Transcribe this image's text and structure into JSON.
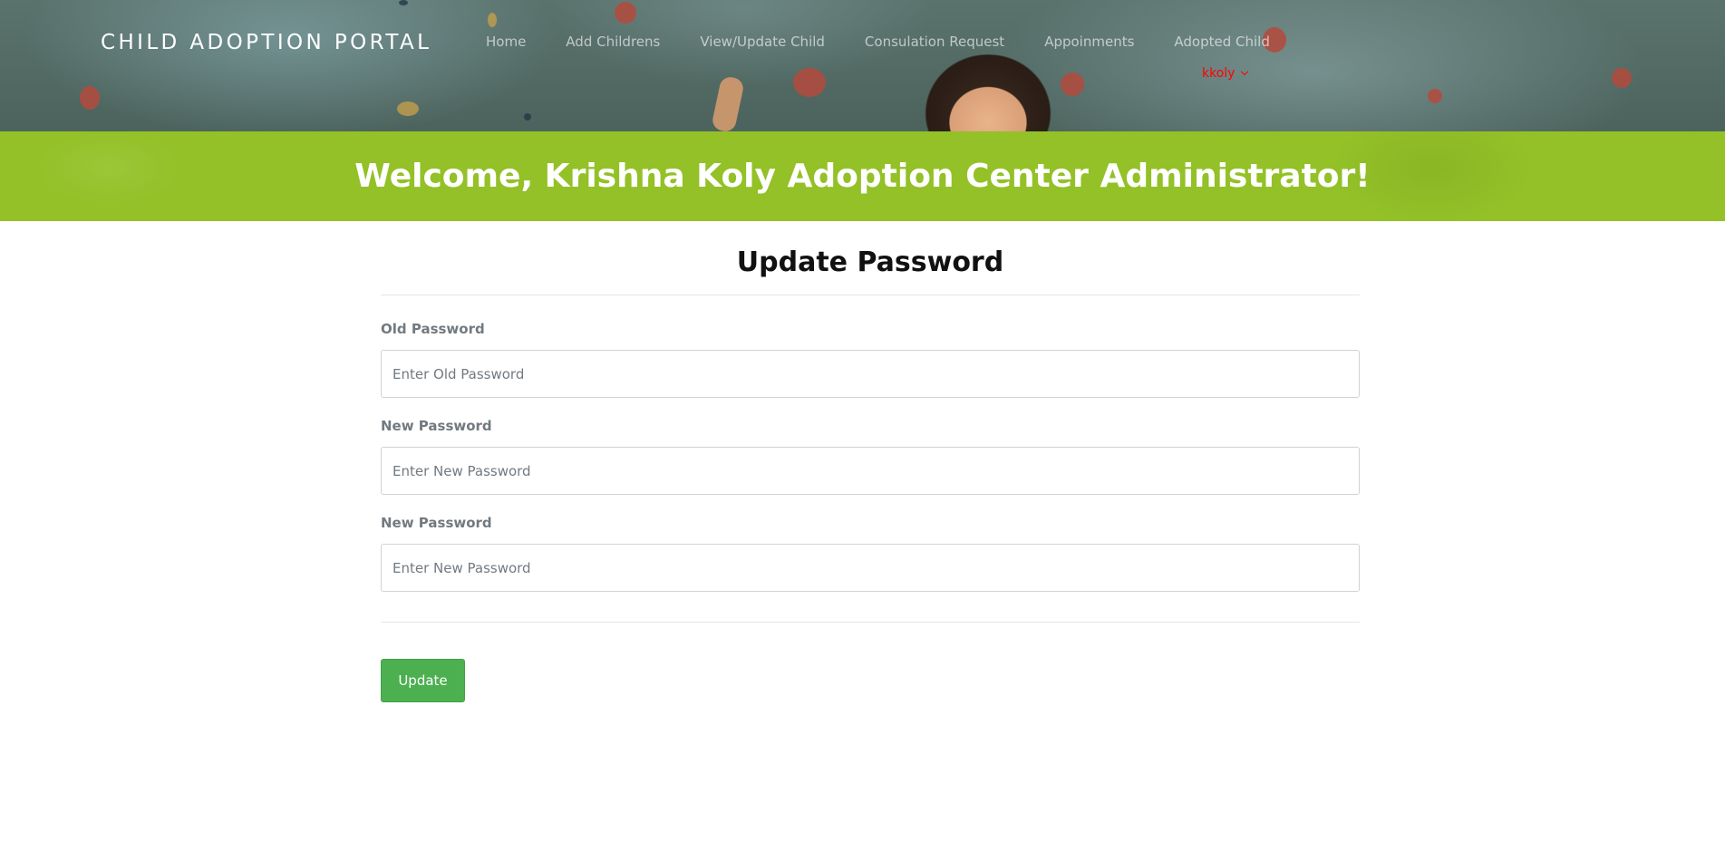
{
  "header": {
    "brand": "CHILD ADOPTION PORTAL",
    "nav": [
      {
        "label": "Home"
      },
      {
        "label": "Add Childrens"
      },
      {
        "label": "View/Update Child"
      },
      {
        "label": "Consulation Request"
      },
      {
        "label": "Appoinments"
      },
      {
        "label": "Adopted Child"
      }
    ],
    "user": "kkoly",
    "welcome": "Welcome, Krishna Koly Adoption Center Administrator!"
  },
  "form": {
    "title": "Update Password",
    "fields": [
      {
        "label": "Old Password",
        "placeholder": "Enter Old Password"
      },
      {
        "label": "New Password",
        "placeholder": "Enter New Password"
      },
      {
        "label": "New Password",
        "placeholder": "Enter New Password"
      }
    ],
    "submit_label": "Update"
  },
  "colors": {
    "band_green": "#93c127",
    "button_green": "#4caf50",
    "user_red": "#ff0000"
  }
}
